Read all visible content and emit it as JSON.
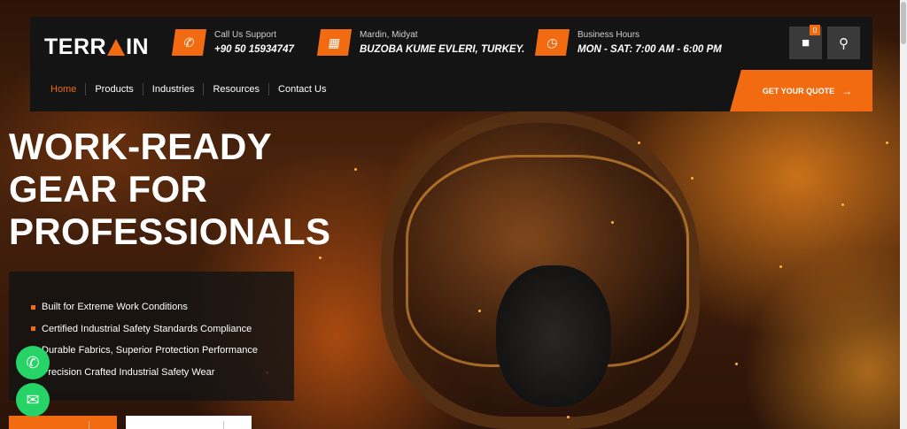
{
  "header": {
    "logo_left": "TERR",
    "logo_right": "IN",
    "support": {
      "label": "Call Us Support",
      "value": "+90 50 15934747",
      "icon": "phone-icon"
    },
    "location": {
      "label": "Mardin, Midyat",
      "value": "BUZOBA KUME EVLERI, TURKEY.",
      "icon": "map-icon"
    },
    "hours": {
      "label": "Business Hours",
      "value": "MON - SAT: 7:00 AM - 6:00 PM",
      "icon": "clock-icon"
    },
    "cart_count": "0"
  },
  "nav": {
    "items": [
      "Home",
      "Products",
      "Industries",
      "Resources",
      "Contact Us"
    ],
    "active": "Home",
    "quote_label": "GET YOUR QUOTE"
  },
  "hero": {
    "headline": [
      "WORK-READY",
      "GEAR FOR",
      "PROFESSIONALS"
    ],
    "features": [
      "Built for Extreme Work Conditions",
      "Certified Industrial Safety Standards Compliance",
      "Durable Fabrics, Superior Protection Performance",
      "Precision Crafted Industrial Safety Wear"
    ]
  },
  "colors": {
    "accent": "#f26b10",
    "header_bg": "#141414",
    "whatsapp": "#25d366"
  }
}
